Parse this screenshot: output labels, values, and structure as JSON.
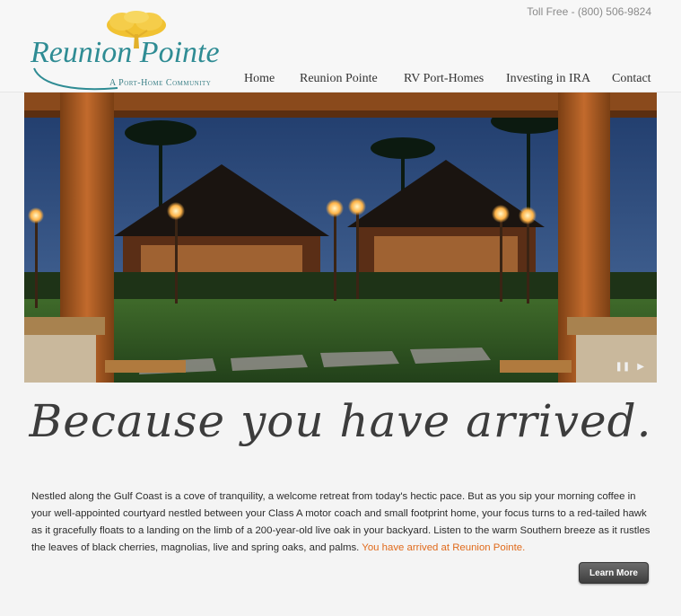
{
  "header": {
    "toll_free": "Toll Free - (800) 506-9824",
    "logo_title": "Reunion Pointe",
    "logo_subtitle": "A Port-Home Community"
  },
  "nav": {
    "items": [
      {
        "label": "Home"
      },
      {
        "label": "Reunion Pointe"
      },
      {
        "label": "RV Port-Homes"
      },
      {
        "label": "Investing in IRA"
      },
      {
        "label": "Contact"
      }
    ]
  },
  "hero": {
    "pause_icon": "pause-icon",
    "play_icon": "play-icon",
    "pause_glyph": "❚❚",
    "play_glyph": "▶"
  },
  "main": {
    "tagline": "Because you have arrived.",
    "paragraph": "Nestled along the Gulf Coast is a cove of tranquility, a welcome retreat from today's hectic pace. But as you sip your morning coffee in your well-appointed courtyard nestled between your Class A motor coach and small footprint home, your focus turns to a red-tailed hawk as it gracefully floats to a landing on the limb of a 200-year-old live oak in your backyard. Listen to the warm Southern breeze as it rustles the leaves of black cherries, magnolias, live and spring oaks, and palms.",
    "highlight": "You have arrived at Reunion Pointe.",
    "learn_more": "Learn More"
  },
  "colors": {
    "brand_teal": "#2f8c94",
    "tree_gold": "#f1c232",
    "highlight_orange": "#e06a1b"
  }
}
